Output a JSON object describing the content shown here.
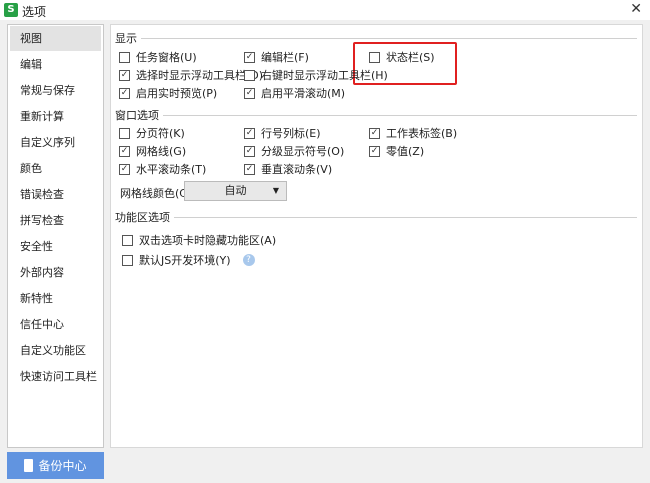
{
  "window": {
    "logo": "S",
    "title": "选项",
    "close": "✕"
  },
  "sidebar": {
    "items": [
      {
        "label": "视图"
      },
      {
        "label": "编辑"
      },
      {
        "label": "常规与保存"
      },
      {
        "label": "重新计算"
      },
      {
        "label": "自定义序列"
      },
      {
        "label": "颜色"
      },
      {
        "label": "错误检查"
      },
      {
        "label": "拼写检查"
      },
      {
        "label": "安全性"
      },
      {
        "label": "外部内容"
      },
      {
        "label": "新特性"
      },
      {
        "label": "信任中心"
      },
      {
        "label": "自定义功能区"
      },
      {
        "label": "快速访问工具栏"
      }
    ]
  },
  "display": {
    "title": "显示",
    "options": [
      {
        "label": "任务窗格(U)",
        "checked": false
      },
      {
        "label": "编辑栏(F)",
        "checked": true
      },
      {
        "label": "状态栏(S)",
        "checked": false
      },
      {
        "label": "选择时显示浮动工具栏(D)",
        "checked": true
      },
      {
        "label": "右键时显示浮动工具栏(H)",
        "checked": false
      },
      {
        "label": "启用实时预览(P)",
        "checked": true
      },
      {
        "label": "启用平滑滚动(M)",
        "checked": true
      }
    ]
  },
  "window_options": {
    "title": "窗口选项",
    "options": [
      {
        "label": "分页符(K)",
        "checked": false
      },
      {
        "label": "行号列标(E)",
        "checked": true
      },
      {
        "label": "工作表标签(B)",
        "checked": true
      },
      {
        "label": "网格线(G)",
        "checked": true
      },
      {
        "label": "分级显示符号(O)",
        "checked": true
      },
      {
        "label": "零值(Z)",
        "checked": true
      },
      {
        "label": "水平滚动条(T)",
        "checked": true
      },
      {
        "label": "垂直滚动条(V)",
        "checked": true
      }
    ],
    "gridline_color_label": "网格线颜色(C):",
    "gridline_color_value": "自动"
  },
  "ribbon": {
    "title": "功能区选项",
    "options": [
      {
        "label": "双击选项卡时隐藏功能区(A)",
        "checked": false
      },
      {
        "label": "默认JS开发环境(Y)",
        "checked": false
      }
    ],
    "help": "?"
  },
  "backup_button": "备份中心",
  "colors": {
    "accent": "#6194e0",
    "highlight": "#e02020"
  }
}
